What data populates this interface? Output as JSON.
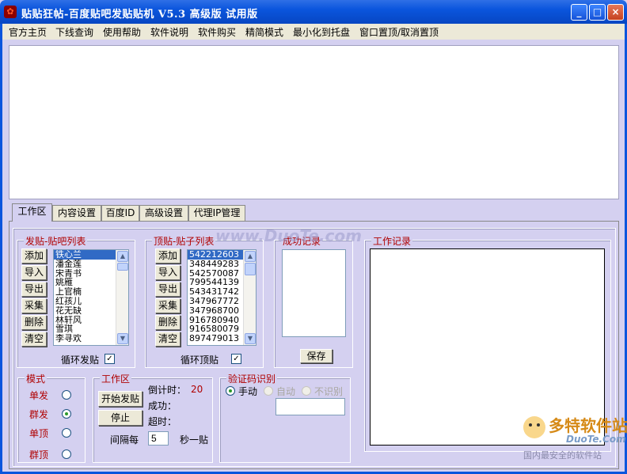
{
  "window": {
    "title": "贴贴狂帖-百度贴吧发贴贴机 V5.3 高级版 试用版",
    "minimize": "_",
    "maximize": "□",
    "close": "×"
  },
  "menu": [
    "官方主页",
    "下线查询",
    "使用帮助",
    "软件说明",
    "软件购买",
    "精简模式",
    "最小化到托盘",
    "窗口置顶/取消置顶"
  ],
  "tabs": [
    "工作区",
    "内容设置",
    "百度ID",
    "高级设置",
    "代理IP管理"
  ],
  "forum_list": {
    "title": "发贴-贴吧列表",
    "buttons": [
      "添加",
      "导入",
      "导出",
      "采集",
      "删除",
      "清空"
    ],
    "items": [
      "铁心兰",
      "潘金莲",
      "宋青书",
      "姚雁",
      "上官楠",
      "红孩儿",
      "花无缺",
      "林轩风",
      "雪琪",
      "李寻欢"
    ],
    "loop_label": "循环发贴",
    "loop_checked": true
  },
  "post_list": {
    "title": "顶贴-贴子列表",
    "buttons": [
      "添加",
      "导入",
      "导出",
      "采集",
      "删除",
      "清空"
    ],
    "items": [
      "542212603",
      "348449283",
      "542570087",
      "799544139",
      "543431742",
      "347967772",
      "347968700",
      "916780940",
      "916580079",
      "897479013"
    ],
    "loop_label": "循环顶贴",
    "loop_checked": true
  },
  "success_log": {
    "title": "成功记录",
    "save_button": "保存"
  },
  "work_log": {
    "title": "工作记录"
  },
  "mode": {
    "title": "模式",
    "options": [
      {
        "label": "单发",
        "checked": false
      },
      {
        "label": "群发",
        "checked": true
      },
      {
        "label": "单顶",
        "checked": false
      },
      {
        "label": "群顶",
        "checked": false
      }
    ]
  },
  "workarea": {
    "title": "工作区",
    "start_button": "开始发贴",
    "stop_button": "停止",
    "countdown_label": "倒计时：",
    "countdown_value": "20",
    "success_label": "成功：",
    "timeout_label": "超时：",
    "interval_label": "间隔每",
    "interval_value": "5",
    "interval_unit": "秒一贴"
  },
  "captcha": {
    "title": "验证码识别",
    "options": [
      {
        "label": "手动",
        "checked": true,
        "enabled": true
      },
      {
        "label": "自动",
        "checked": false,
        "enabled": false
      },
      {
        "label": "不识别",
        "checked": false,
        "enabled": false
      }
    ]
  },
  "watermark": {
    "center": "www.DuoTe.com",
    "brand": "多特软件站",
    "brand_url": "DuoTe.Com",
    "slogan": "国内最安全的软件站"
  }
}
